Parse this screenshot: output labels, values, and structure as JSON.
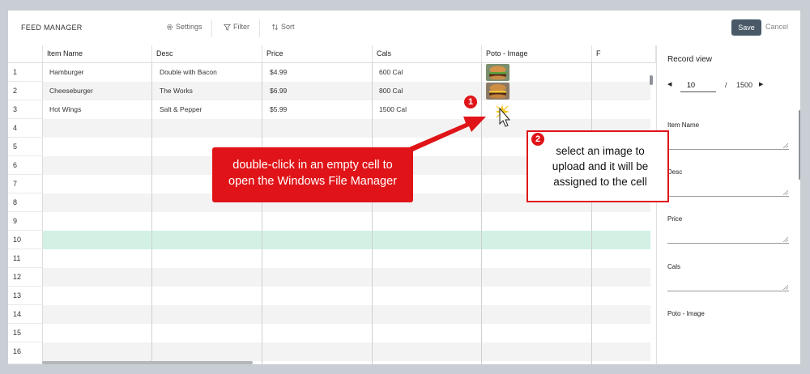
{
  "toolbar": {
    "title": "FEED MANAGER",
    "settings_label": "Settings",
    "filter_label": "Filter",
    "sort_label": "Sort",
    "save_label": "Save",
    "cancel_label": "Cancel"
  },
  "grid": {
    "columns": [
      "Item Name",
      "Desc",
      "Price",
      "Cals",
      "Poto - Image",
      "F"
    ],
    "rows": [
      {
        "num": "1",
        "item": "Hamburger",
        "desc": "Double with Bacon",
        "price": "$4.99",
        "cals": "600 Cal"
      },
      {
        "num": "2",
        "item": "Cheeseburger",
        "desc": "The Works",
        "price": "$6.99",
        "cals": "800 Cal"
      },
      {
        "num": "3",
        "item": "Hot Wings",
        "desc": "Salt & Pepper",
        "price": "$5.99",
        "cals": "1500 Cal"
      },
      {
        "num": "4"
      },
      {
        "num": "5"
      },
      {
        "num": "6"
      },
      {
        "num": "7"
      },
      {
        "num": "8"
      },
      {
        "num": "9"
      },
      {
        "num": "10"
      },
      {
        "num": "11"
      },
      {
        "num": "12"
      },
      {
        "num": "13"
      },
      {
        "num": "14"
      },
      {
        "num": "15"
      },
      {
        "num": "16"
      }
    ],
    "highlight_color": "#d2f1e4"
  },
  "record_view": {
    "title": "Record view",
    "current": "10",
    "separator": "/",
    "total": "1500",
    "fields": [
      "Item Name",
      "Desc",
      "Price",
      "Cals",
      "Poto - Image"
    ]
  },
  "callouts": {
    "one_badge": "1",
    "one_text_line1": "double-click in an empty cell to",
    "one_text_line2": "open the Windows File Manager",
    "two_badge": "2",
    "two_text_line1": "select an image to",
    "two_text_line2": "upload and it will be",
    "two_text_line3": "assigned to the cell"
  },
  "colors": {
    "accent_red": "#e01418",
    "save_button": "#495967",
    "row_stripe": "#f3f3f3"
  }
}
